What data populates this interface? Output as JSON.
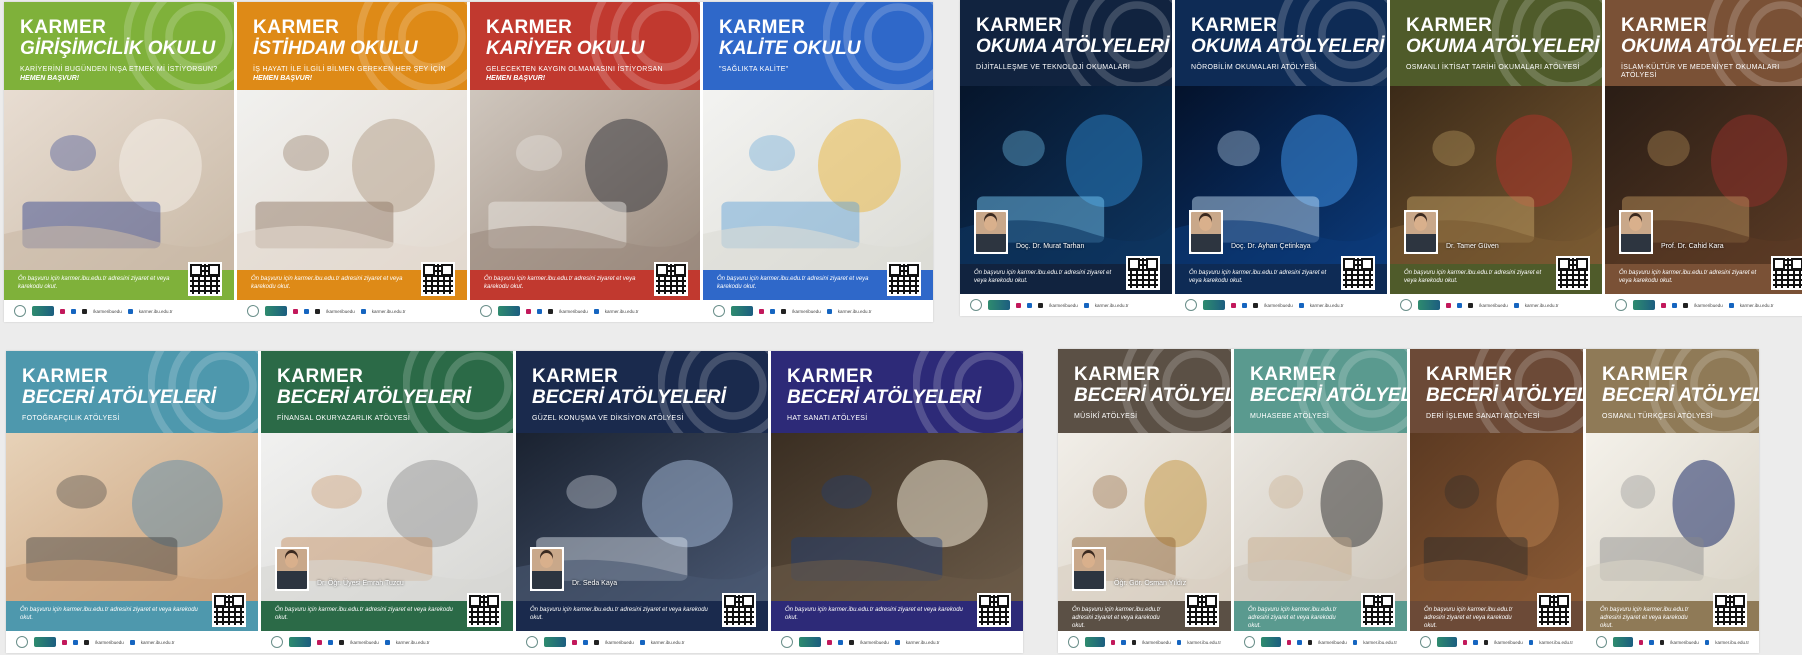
{
  "brand": "KARMER",
  "apply_text": "Ön başvuru için karmer.ibu.edu.tr adresini ziyaret et veya karekodu okut.",
  "footer": {
    "handle": "/karmeribuedu",
    "site": "karmer.ibu.edu.tr"
  },
  "colors": {
    "green": "#7fb13a",
    "orange": "#de8a17",
    "red": "#c1392f",
    "blue": "#2f68c9",
    "navy": "#11233f",
    "deepblue": "#0e2b55",
    "olive": "#4f5b2a",
    "brown": "#7a5136",
    "skyteal": "#4e98ad",
    "forest": "#2b6a47",
    "darknavy": "#1a2a4d",
    "indigo": "#2d2a78",
    "taupe": "#5b5045",
    "teal": "#5a9a8f",
    "rust": "#6c4a37",
    "sand": "#8f7a57"
  },
  "posters_top_left": [
    {
      "title": "GİRİŞİMCİLİK OKULU",
      "sub": "KARİYERİNİ BUGÜNDEN İNŞA ETMEK Mİ İSTİYORSUN?",
      "sub2": "HEMEN BAŞVUR!",
      "color": "green",
      "scene": "writing",
      "person": ""
    },
    {
      "title": "İSTİHDAM OKULU",
      "sub": "İŞ HAYATI İLE İLGİLİ BİLMEN GEREKEN HER ŞEY İÇİN",
      "sub2": "HEMEN BAŞVUR!",
      "color": "orange",
      "scene": "handshake",
      "person": ""
    },
    {
      "title": "KARİYER OKULU",
      "sub": "GELECEKTEN KAYGIN OLMAMASINI İSTİYORSAN",
      "sub2": "HEMEN BAŞVUR!",
      "color": "red",
      "scene": "meeting",
      "person": ""
    },
    {
      "title": "KALİTE OKULU",
      "sub": "\"SAĞLIKTA KALİTE\"",
      "sub2": "",
      "color": "blue",
      "scene": "charts",
      "person": ""
    }
  ],
  "posters_top_right": [
    {
      "title": "OKUMA ATÖLYELERİ",
      "sub": "DİJİTALLEŞME VE TEKNOLOJİ OKUMALARI",
      "sub2": "",
      "color": "navy",
      "scene": "tech",
      "person": "Doç. Dr. Murat Tarhan"
    },
    {
      "title": "OKUMA ATÖLYELERİ",
      "sub": "NÖROBİLİM OKUMALARI ATÖLYESİ",
      "sub2": "",
      "color": "deepblue",
      "scene": "neuron",
      "person": "Doç. Dr. Ayhan Çetinkaya"
    },
    {
      "title": "OKUMA ATÖLYELERİ",
      "sub": "OSMANLI İKTİSAT TARİHİ OKUMALARI ATÖLYESİ",
      "sub2": "",
      "color": "olive",
      "scene": "painting",
      "person": "Dr. Tamer Güven"
    },
    {
      "title": "OKUMA ATÖLYELERİ",
      "sub": "İSLAM-KÜLTÜR VE MEDENİYET OKUMALARI ATÖLYESİ",
      "sub2": "",
      "color": "brown",
      "scene": "books",
      "person": "Prof. Dr. Cahid Kara"
    }
  ],
  "posters_bottom_left": [
    {
      "title": "BECERİ ATÖLYELERİ",
      "sub": "FOTOĞRAFÇILIK ATÖLYESİ",
      "sub2": "",
      "color": "skyteal",
      "scene": "camera",
      "person": ""
    },
    {
      "title": "BECERİ ATÖLYELERİ",
      "sub": "FİNANSAL OKURYAZARLIK ATÖLYESİ",
      "sub2": "",
      "color": "forest",
      "scene": "finance",
      "person": "Dr. Öğr. Üyesi Emrah Tuzcu"
    },
    {
      "title": "BECERİ ATÖLYELERİ",
      "sub": "GÜZEL KONUŞMA VE DİKSİYON ATÖLYESİ",
      "sub2": "",
      "color": "darknavy",
      "scene": "crowd",
      "person": "Dr. Seda Kaya"
    },
    {
      "title": "BECERİ ATÖLYELERİ",
      "sub": "HAT SANATI ATÖLYESİ",
      "sub2": "",
      "color": "indigo",
      "scene": "calligraphy",
      "person": ""
    }
  ],
  "posters_bottom_right": [
    {
      "title": "BECERİ ATÖLYELERİ",
      "sub": "MÛSİKÎ ATÖLYESİ",
      "sub2": "",
      "color": "taupe",
      "scene": "music",
      "person": "Öğr. Gör. Osman Yıldız"
    },
    {
      "title": "BECERİ ATÖLYELERİ",
      "sub": "MUHASEBE ATÖLYESİ",
      "sub2": "",
      "color": "teal",
      "scene": "accounting",
      "person": ""
    },
    {
      "title": "BECERİ ATÖLYELERİ",
      "sub": "DERİ İŞLEME SANATI ATÖLYESİ",
      "sub2": "",
      "color": "rust",
      "scene": "leather",
      "person": ""
    },
    {
      "title": "BECERİ ATÖLYELERİ",
      "sub": "OSMANLI TÜRKÇESİ ATÖLYESİ",
      "sub2": "",
      "color": "sand",
      "scene": "script",
      "person": ""
    }
  ]
}
